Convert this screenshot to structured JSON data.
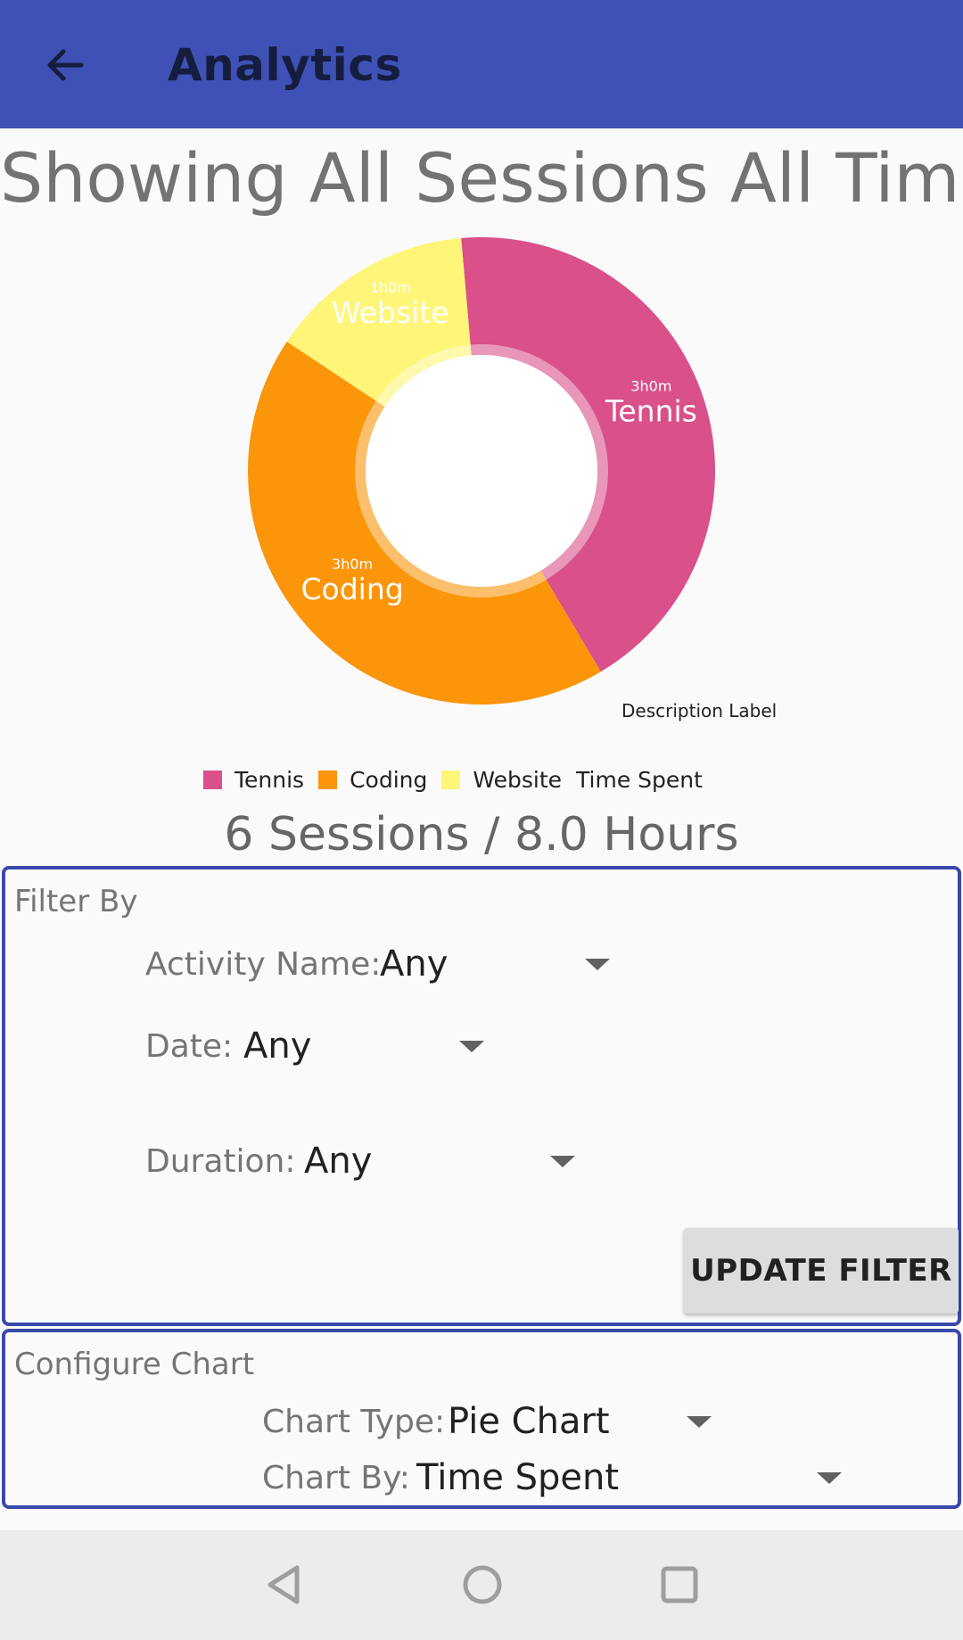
{
  "appbar": {
    "title": "Analytics"
  },
  "headline": "Showing All Sessions All Time",
  "chart_data": {
    "type": "pie",
    "categories": [
      "Tennis",
      "Coding",
      "Website"
    ],
    "values": [
      3.0,
      3.0,
      1.0
    ],
    "value_labels": [
      "3h0m",
      "3h0m",
      "1h0m"
    ],
    "colors": [
      "#d9508b",
      "#fb950a",
      "#fff578"
    ],
    "legend_title": "Time Spent",
    "description": "Description Label",
    "legend_position": "bottom"
  },
  "summary": "6 Sessions / 8.0 Hours",
  "filter": {
    "title": "Filter By",
    "activity_label": "Activity Name:",
    "activity_value": "Any",
    "date_label": "Date:",
    "date_value": "Any",
    "duration_label": "Duration:",
    "duration_value": "Any",
    "button_label": "UPDATE FILTER"
  },
  "configure": {
    "title": "Configure Chart",
    "type_label": "Chart Type:",
    "type_value": "Pie Chart",
    "by_label": "Chart By:",
    "by_value": "Time Spent"
  },
  "colors": {
    "appbar": "#3f51b5",
    "card_border": "#3949ab"
  },
  "icons": {
    "back": "arrow-left-icon",
    "nav_back": "triangle-back-icon",
    "nav_home": "circle-home-icon",
    "nav_recents": "square-recents-icon"
  }
}
